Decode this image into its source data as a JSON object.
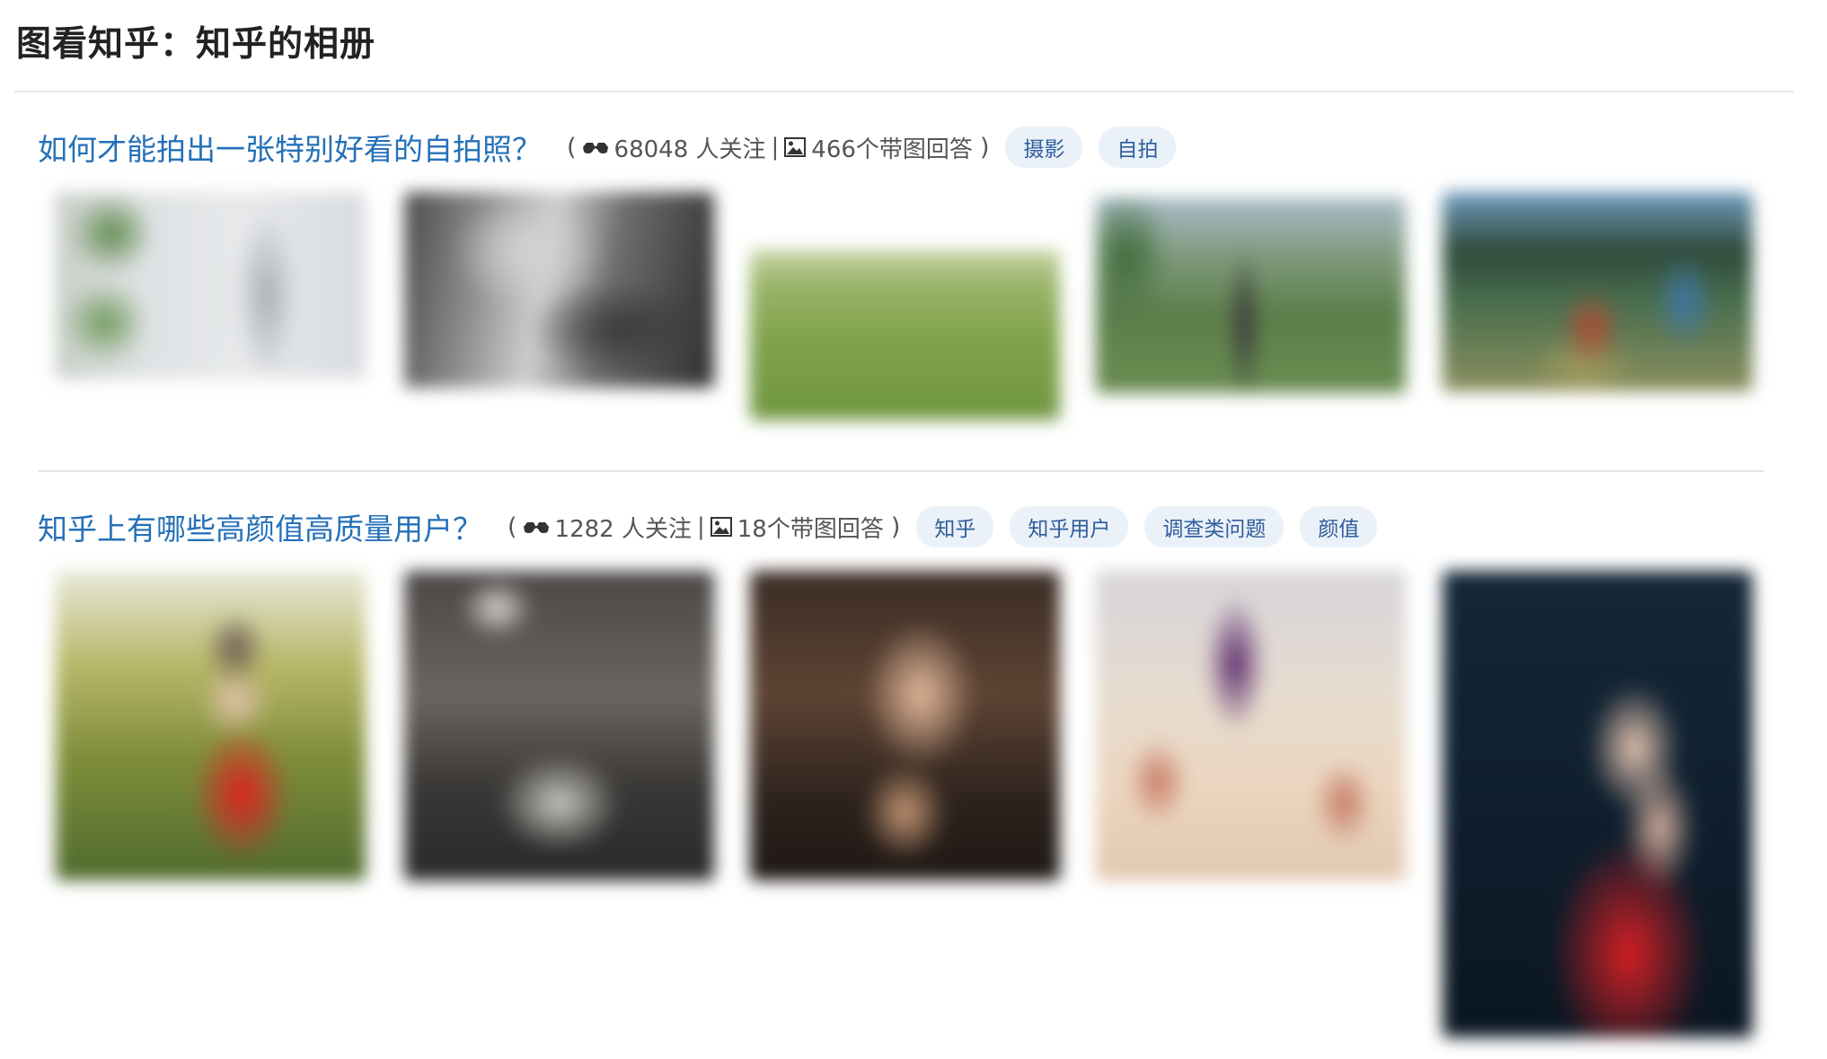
{
  "page": {
    "title": "图看知乎：知乎的相册"
  },
  "questions": [
    {
      "title": "如何才能拍出一张特别好看的自拍照？",
      "paren_open": "(",
      "followers": "68048 人关注",
      "separator": "|",
      "answers": "466个带图回答",
      "paren_close": ")",
      "tags": [
        "摄影",
        "自拍"
      ]
    },
    {
      "title": "知乎上有哪些高颜值高质量用户？",
      "paren_open": "(",
      "followers": "1282 人关注",
      "separator": "|",
      "answers": "18个带图回答",
      "paren_close": ")",
      "tags": [
        "知乎",
        "知乎用户",
        "调查类问题",
        "颜值"
      ]
    }
  ],
  "icons": {
    "followers": "glasses-icon",
    "answers": "image-icon"
  },
  "colors": {
    "link": "#2470b8",
    "tag_bg": "#eaf1f9",
    "tag_text": "#2f5d9a",
    "divider": "#e6e6e6"
  }
}
